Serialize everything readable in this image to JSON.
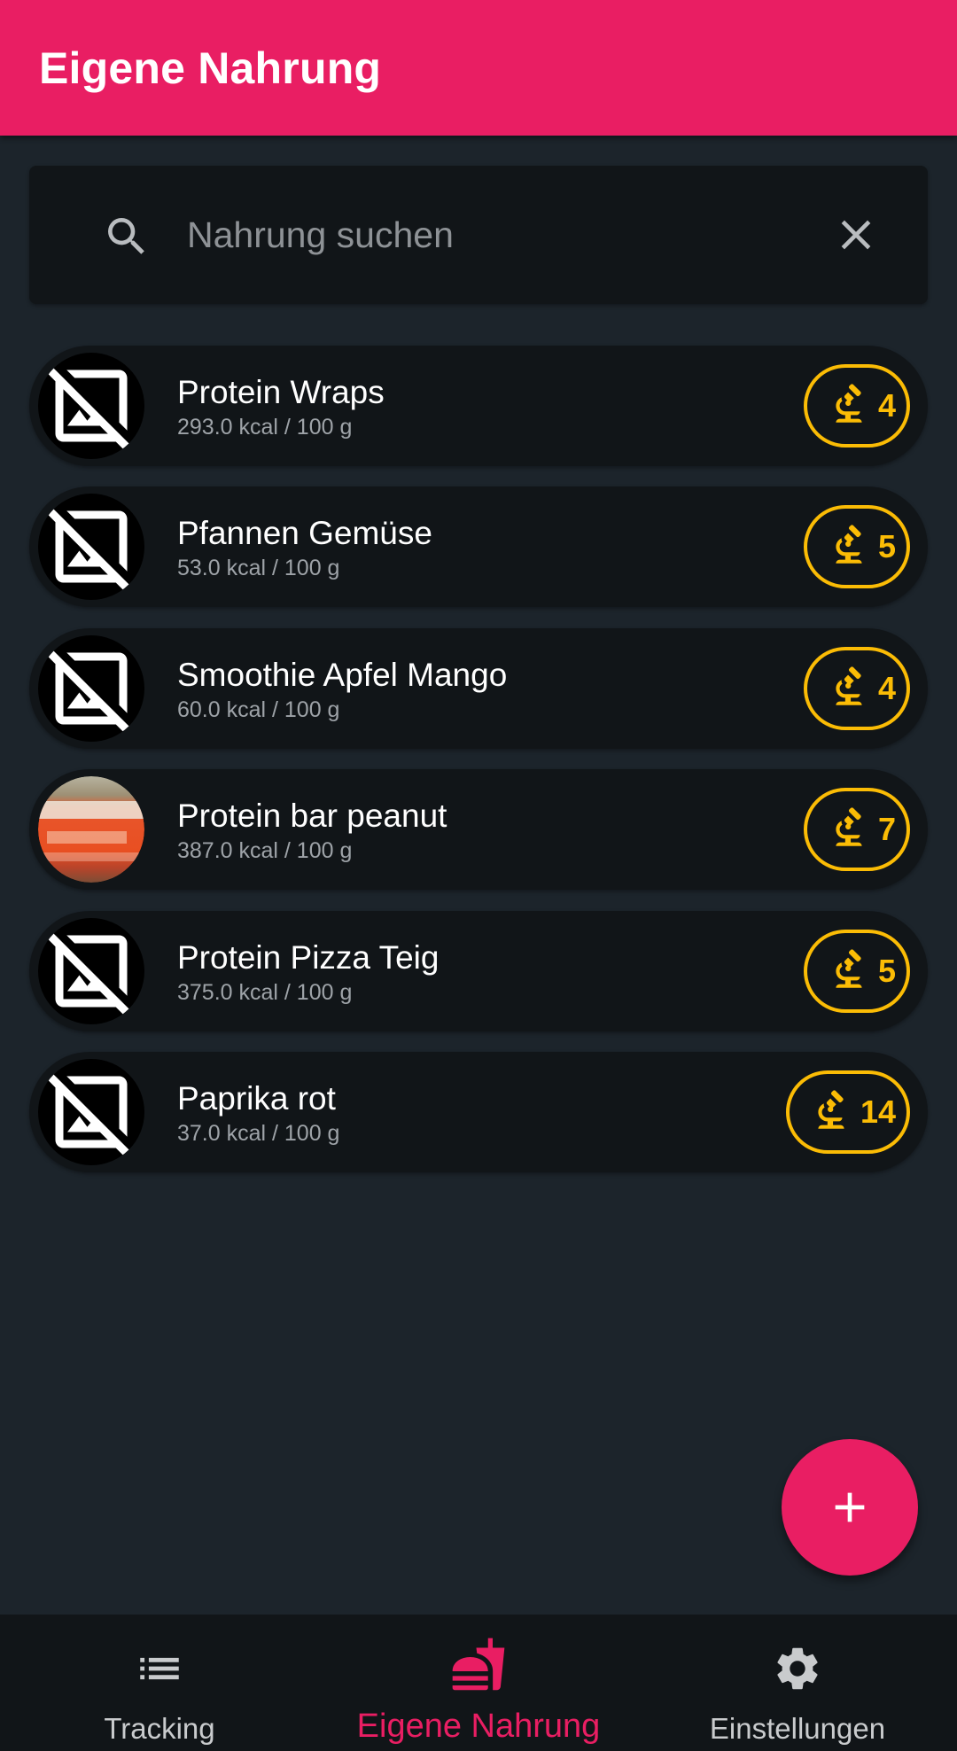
{
  "appbar": {
    "title": "Eigene Nahrung"
  },
  "search": {
    "placeholder": "Nahrung suchen",
    "value": ""
  },
  "foods": [
    {
      "name": "Protein Wraps",
      "subtitle": "293.0 kcal / 100 g",
      "count": "4",
      "image": "no-image-icon"
    },
    {
      "name": "Pfannen Gemüse",
      "subtitle": "53.0 kcal / 100 g",
      "count": "5",
      "image": "no-image-icon"
    },
    {
      "name": "Smoothie Apfel Mango",
      "subtitle": "60.0 kcal / 100 g",
      "count": "4",
      "image": "no-image-icon"
    },
    {
      "name": "Protein bar peanut",
      "subtitle": "387.0 kcal / 100 g",
      "count": "7",
      "image": "product-photo"
    },
    {
      "name": "Protein Pizza Teig",
      "subtitle": "375.0 kcal / 100 g",
      "count": "5",
      "image": "no-image-icon"
    },
    {
      "name": "Paprika rot",
      "subtitle": "37.0 kcal / 100 g",
      "count": "14",
      "image": "no-image-icon"
    }
  ],
  "fab": {
    "icon": "plus-icon"
  },
  "bottom_nav": {
    "items": [
      {
        "label": "Tracking",
        "icon": "list-icon",
        "active": false
      },
      {
        "label": "Eigene Nahrung",
        "icon": "fastfood-icon",
        "active": true
      },
      {
        "label": "Einstellungen",
        "icon": "gear-icon",
        "active": false
      }
    ]
  },
  "colors": {
    "primary": "#e91e63",
    "background": "#1c242b",
    "surface": "#111518",
    "badge": "#fbbc05"
  }
}
